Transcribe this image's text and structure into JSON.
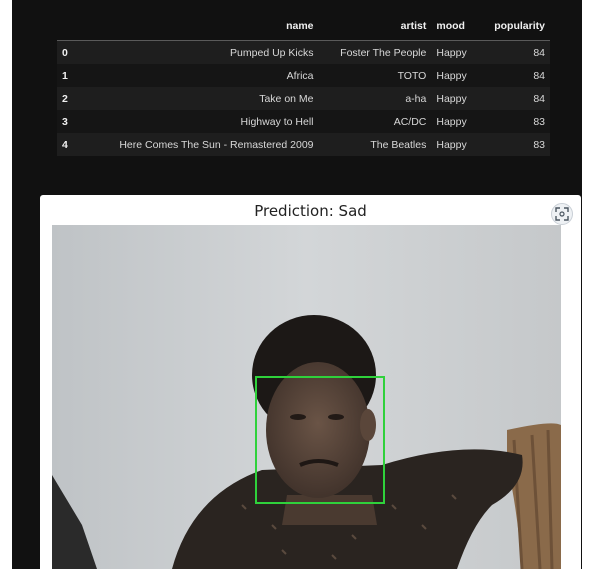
{
  "table": {
    "columns": [
      "",
      "name",
      "artist",
      "mood",
      "popularity"
    ],
    "rows": [
      {
        "index": "0",
        "name": "Pumped Up Kicks",
        "artist": "Foster The People",
        "mood": "Happy",
        "popularity": "84"
      },
      {
        "index": "1",
        "name": "Africa",
        "artist": "TOTO",
        "mood": "Happy",
        "popularity": "84"
      },
      {
        "index": "2",
        "name": "Take on Me",
        "artist": "a-ha",
        "mood": "Happy",
        "popularity": "84"
      },
      {
        "index": "3",
        "name": "Highway to Hell",
        "artist": "AC/DC",
        "mood": "Happy",
        "popularity": "83"
      },
      {
        "index": "4",
        "name": "Here Comes The Sun - Remastered 2009",
        "artist": "The Beatles",
        "mood": "Happy",
        "popularity": "83"
      }
    ]
  },
  "plot": {
    "title": "Prediction: Sad",
    "expand_icon": "fullscreen-icon",
    "face_box_color": "#2fd13b"
  },
  "colors": {
    "background": "#111111",
    "header_text": "#f0f0f0",
    "cell_text": "#d8d8d8"
  }
}
